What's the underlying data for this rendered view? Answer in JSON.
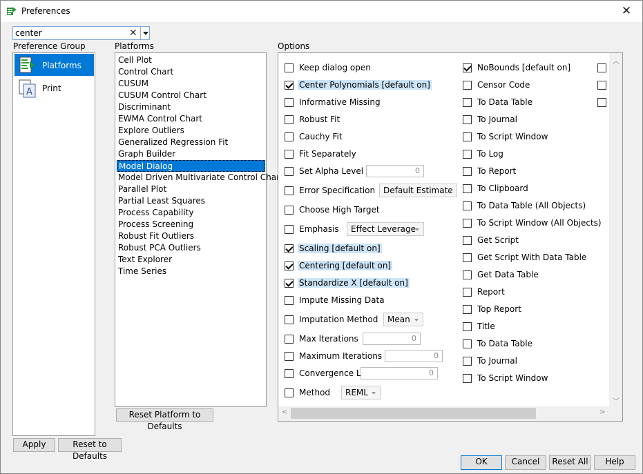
{
  "window": {
    "title": "Preferences"
  },
  "search": {
    "value": "center"
  },
  "labels": {
    "preference_group": "Preference Group",
    "platforms": "Platforms",
    "options": "Options"
  },
  "groups": [
    {
      "label": "Platforms",
      "icon": "platforms-icon",
      "selected": true
    },
    {
      "label": "Print",
      "icon": "print-icon",
      "selected": false
    }
  ],
  "platforms": [
    "Cell Plot",
    "Control Chart",
    "CUSUM",
    "CUSUM Control Chart",
    "Discriminant",
    "EWMA Control Chart",
    "Explore Outliers",
    "Generalized Regression Fit",
    "Graph Builder",
    "Model Dialog",
    "Model Driven Multivariate Control Chart",
    "Parallel Plot",
    "Partial Least Squares",
    "Process Capability",
    "Process Screening",
    "Robust Fit Outliers",
    "Robust PCA Outliers",
    "Text Explorer",
    "Time Series"
  ],
  "selected_platform": "Model Dialog",
  "options_col1": [
    {
      "label": "Keep dialog open",
      "checked": false
    },
    {
      "label": "Center Polynomials [default on]",
      "checked": true
    },
    {
      "label": "Informative Missing",
      "checked": false
    },
    {
      "label": "Robust Fit",
      "checked": false
    },
    {
      "label": "Cauchy Fit",
      "checked": false
    },
    {
      "label": "Fit Separately",
      "checked": false
    },
    {
      "label": "Set Alpha Level",
      "checked": false,
      "number": "0"
    },
    {
      "label": "Error Specification",
      "checked": false,
      "select": "Default Estimate"
    },
    {
      "label": "Choose High Target",
      "checked": false
    },
    {
      "label": "Emphasis",
      "checked": false,
      "select": "Effect Leverage"
    },
    {
      "label": "Scaling [default on]",
      "checked": true
    },
    {
      "label": "Centering [default on]",
      "checked": true
    },
    {
      "label": "Standardize X [default on]",
      "checked": true
    },
    {
      "label": "Impute Missing Data",
      "checked": false
    },
    {
      "label": "Imputation Method",
      "checked": false,
      "select": "Mean"
    },
    {
      "label": "Max Iterations",
      "checked": false,
      "number": "0"
    },
    {
      "label": "Maximum Iterations",
      "checked": false,
      "number": "0"
    },
    {
      "label": "Convergence Limit",
      "checked": false,
      "number": "0"
    },
    {
      "label": "Method",
      "checked": false,
      "select": "REML"
    }
  ],
  "options_col2": [
    {
      "label": "NoBounds [default on]",
      "checked": true
    },
    {
      "label": "Censor Code",
      "checked": false
    },
    {
      "label": "To Data Table",
      "checked": false
    },
    {
      "label": "To Journal",
      "checked": false
    },
    {
      "label": "To Script Window",
      "checked": false
    },
    {
      "label": "To Log",
      "checked": false
    },
    {
      "label": "To Report",
      "checked": false
    },
    {
      "label": "To Clipboard",
      "checked": false
    },
    {
      "label": "To Data Table (All Objects)",
      "checked": false
    },
    {
      "label": "To Script Window (All Objects)",
      "checked": false
    },
    {
      "label": "Get Script",
      "checked": false
    },
    {
      "label": "Get Script With Data Table",
      "checked": false
    },
    {
      "label": "Get Data Table",
      "checked": false
    },
    {
      "label": "Report",
      "checked": false
    },
    {
      "label": "Top Report",
      "checked": false
    },
    {
      "label": "Title",
      "checked": false
    },
    {
      "label": "To Data Table",
      "checked": false
    },
    {
      "label": "To Journal",
      "checked": false
    },
    {
      "label": "To Script Window",
      "checked": false
    }
  ],
  "options_col3_count": 3,
  "buttons": {
    "reset_platform": "Reset Platform to Defaults",
    "apply": "Apply",
    "reset_defaults": "Reset to Defaults",
    "ok": "OK",
    "cancel": "Cancel",
    "reset_all": "Reset All",
    "help": "Help"
  }
}
